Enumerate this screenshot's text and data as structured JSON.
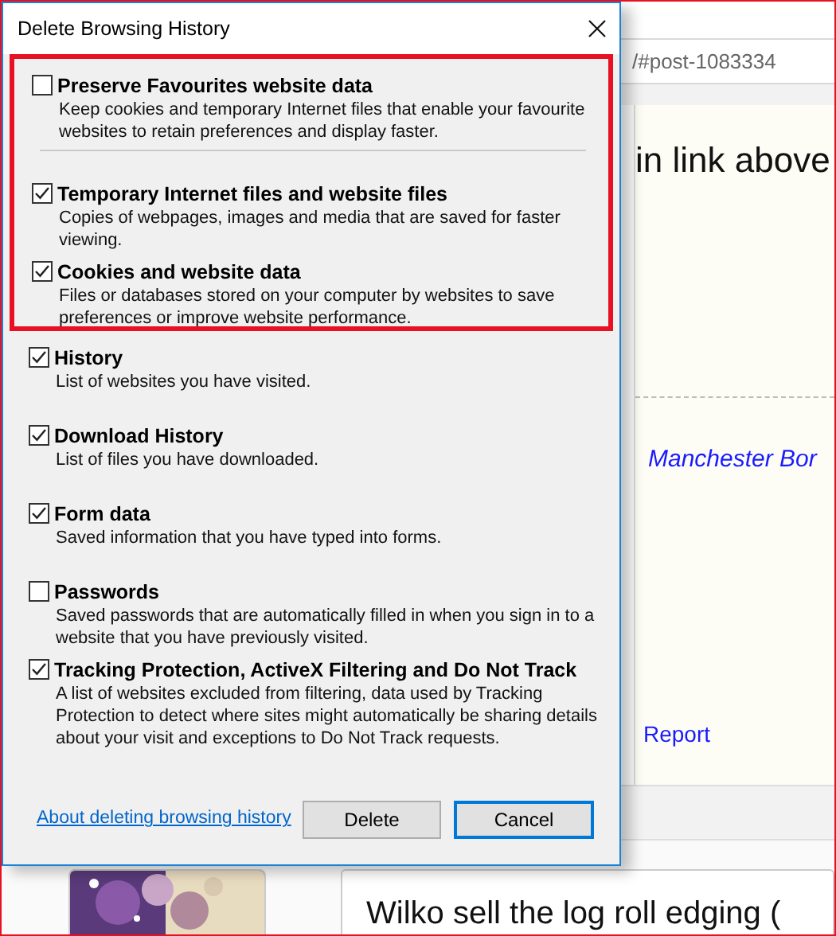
{
  "window": {
    "title": "Delete Browsing History"
  },
  "sections": [
    {
      "highlighted": true,
      "items": [
        {
          "label": "Preserve Favourites website data",
          "description": "Keep cookies and temporary Internet files that enable your favourite websites to retain preferences and display faster.",
          "checked": false,
          "separator_after": true
        },
        {
          "label": "Temporary Internet files and website files",
          "description": "Copies of webpages, images and media that are saved for faster viewing.",
          "checked": true,
          "separator_after": false
        },
        {
          "label": "Cookies and website data",
          "description": "Files or databases stored on your computer by websites to save preferences or improve website performance.",
          "checked": true,
          "separator_after": false
        }
      ]
    },
    {
      "highlighted": false,
      "items": [
        {
          "label": "History",
          "description": "List of websites you have visited.",
          "checked": true,
          "separator_after": false
        },
        {
          "label": "Download History",
          "description": "List of files you have downloaded.",
          "checked": true,
          "separator_after": false
        },
        {
          "label": "Form data",
          "description": "Saved information that you have typed into forms.",
          "checked": true,
          "separator_after": false
        },
        {
          "label": "Passwords",
          "description": "Saved passwords that are automatically filled in when you sign in to a website that you have previously visited.",
          "checked": false,
          "separator_after": false
        },
        {
          "label": "Tracking Protection, ActiveX Filtering and Do Not Track",
          "description": "A list of websites excluded from filtering, data used by Tracking Protection to detect where sites might automatically be sharing details about your visit and exceptions to Do Not Track requests.",
          "checked": true,
          "separator_after": false
        }
      ]
    }
  ],
  "link": "About deleting browsing history",
  "buttons": [
    {
      "label": "Delete",
      "default": false
    },
    {
      "label": "Cancel",
      "default": true
    }
  ],
  "browser": {
    "address": "/#post-1083334",
    "heading": "in link above",
    "link": "Manchester Bor",
    "report_link": "Report",
    "post_text": "Wilko sell the log roll edging ("
  }
}
